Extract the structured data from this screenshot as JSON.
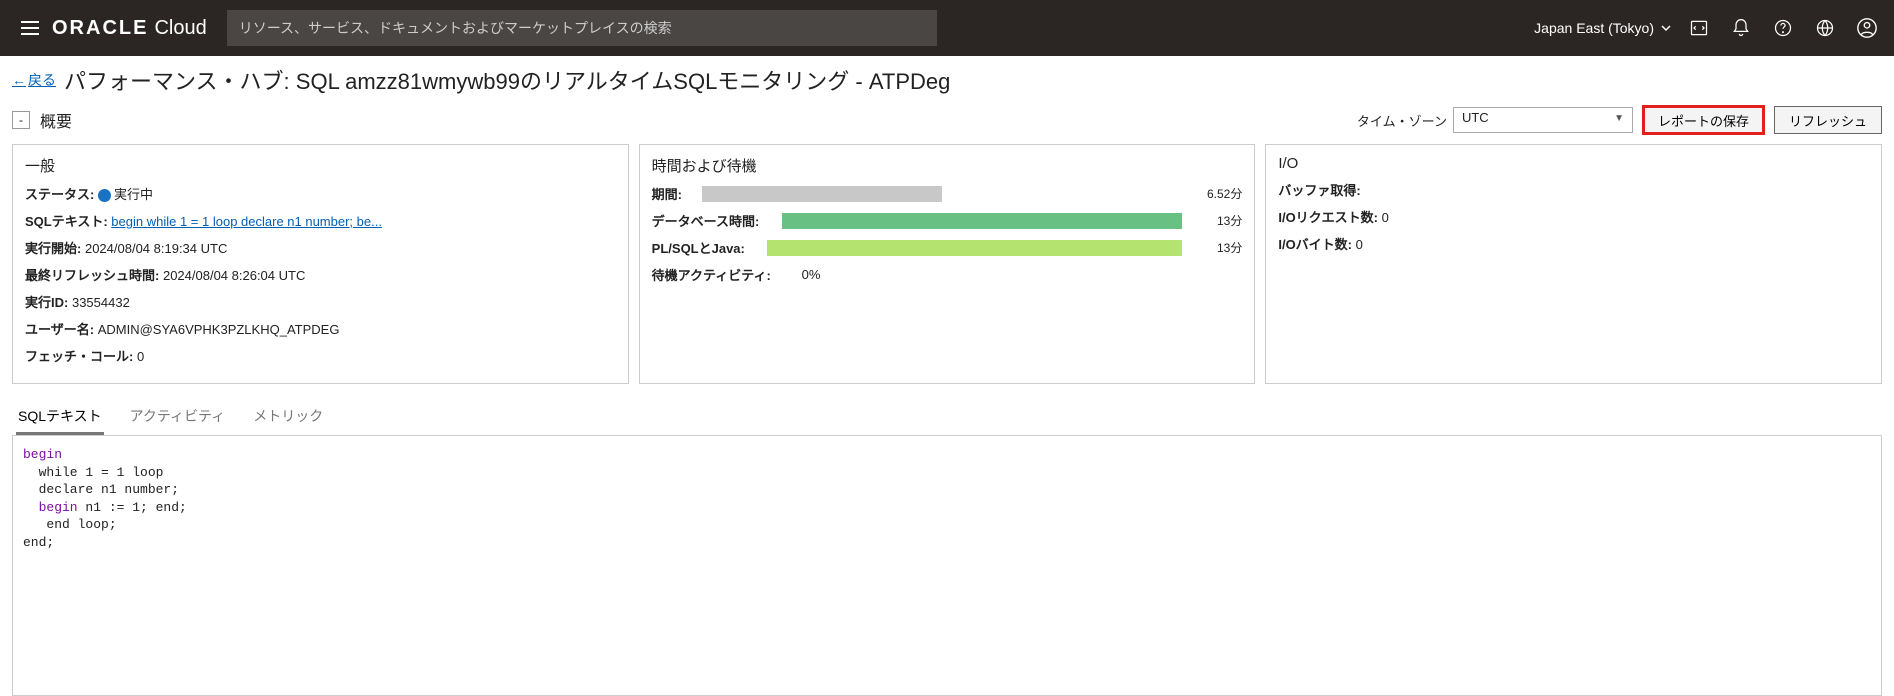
{
  "header": {
    "brand_main": "ORACLE",
    "brand_sub": "Cloud",
    "search_placeholder": "リソース、サービス、ドキュメントおよびマーケットプレイスの検索",
    "region": "Japan East (Tokyo)"
  },
  "breadcrumb": {
    "back": "戻る",
    "title": "パフォーマンス・ハブ: SQL amzz81wmywb99のリアルタイムSQLモニタリング - ATPDeg"
  },
  "section": {
    "overview_label": "概要",
    "timezone_label": "タイム・ゾーン",
    "timezone_value": "UTC",
    "save_report": "レポートの保存",
    "refresh": "リフレッシュ"
  },
  "panel_general": {
    "title": "一般",
    "status_k": "ステータス:",
    "status_v": "実行中",
    "sqltext_k": "SQLテキスト:",
    "sqltext_v": "begin while 1 = 1 loop declare n1 number; be...",
    "start_k": "実行開始:",
    "start_v": "2024/08/04 8:19:34 UTC",
    "refresh_k": "最終リフレッシュ時間:",
    "refresh_v": "2024/08/04 8:26:04 UTC",
    "execid_k": "実行ID:",
    "execid_v": "33554432",
    "user_k": "ユーザー名:",
    "user_v": "ADMIN@SYA6VPHK3PZLKHQ_ATPDEG",
    "fetch_k": "フェッチ・コール:",
    "fetch_v": "0"
  },
  "panel_time": {
    "title": "時間および待機",
    "duration_k": "期間:",
    "duration_v": "6.52分",
    "db_k": "データベース時間:",
    "db_v": "13分",
    "plsql_k": "PL/SQLとJava:",
    "plsql_v": "13分",
    "wait_k": "待機アクティビティ:",
    "wait_v": "0%",
    "bars": {
      "duration_pct": 50,
      "db_pct": 92,
      "plsql_pct": 92
    }
  },
  "panel_io": {
    "title": "I/O",
    "buf_k": "バッファ取得:",
    "buf_v": "",
    "req_k": "I/Oリクエスト数:",
    "req_v": "0",
    "bytes_k": "I/Oバイト数:",
    "bytes_v": "0"
  },
  "tabs": {
    "sqltext": "SQLテキスト",
    "activity": "アクティビティ",
    "metric": "メトリック"
  },
  "sql": {
    "l1": "begin",
    "l2": "  while 1 = 1 loop",
    "l3": "  declare n1 number;",
    "l4_a": "  begin",
    "l4_b": " n1 := 1; end;",
    "l5": "   end loop;",
    "l6": "end;"
  }
}
